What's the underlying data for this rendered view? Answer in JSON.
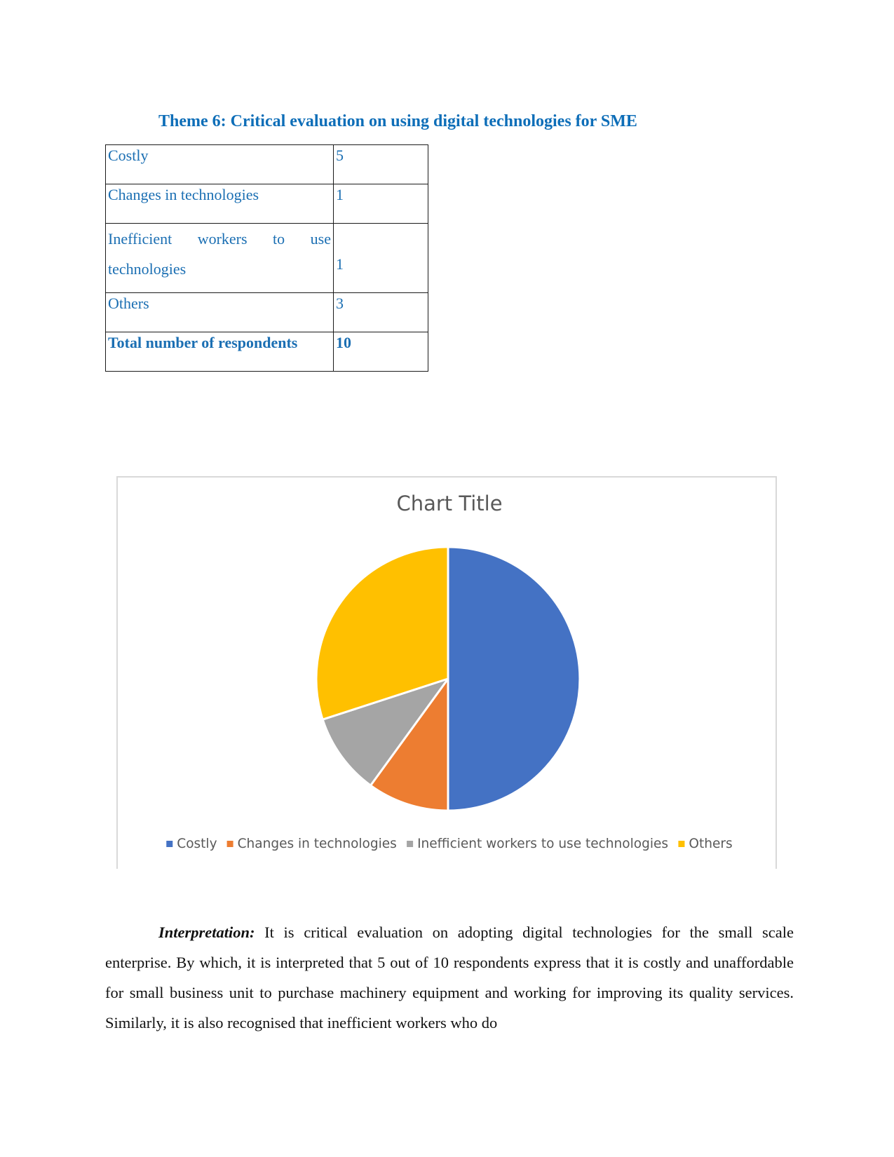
{
  "document": {
    "theme_heading": "Theme 6: Critical evaluation on using digital technologies for SME",
    "table": {
      "rows": [
        {
          "label": "Costly",
          "value": "5"
        },
        {
          "label": "Changes in technologies",
          "value": "1"
        },
        {
          "label": "Inefficient workers to use technologies",
          "value": "1"
        },
        {
          "label": "Others",
          "value": "3"
        }
      ],
      "total": {
        "label": "Total number of respondents",
        "value": "10"
      }
    },
    "interpretation": {
      "lead": "Interpretation:",
      "text": " It is critical evaluation on adopting digital technologies for the small scale enterprise. By which, it is interpreted that 5 out of 10 respondents express that it is costly and unaffordable for small business unit to purchase machinery equipment and working for improving its quality services. Similarly, it is also recognised that inefficient workers who do"
    }
  },
  "colors": {
    "heading": "#0e6eb8",
    "table_text": "#1b6fb3",
    "slice_costly": "#4472c4",
    "slice_changes": "#ed7d31",
    "slice_inefficient": "#a5a5a5",
    "slice_others": "#ffc000"
  },
  "chart_data": {
    "type": "pie",
    "title": "Chart Title",
    "categories": [
      "Costly",
      "Changes in technologies",
      "Inefficient workers to use technologies",
      "Others"
    ],
    "values": [
      5,
      1,
      1,
      3
    ],
    "colors": [
      "#4472c4",
      "#ed7d31",
      "#a5a5a5",
      "#ffc000"
    ],
    "start_angle": "12 o'clock, clockwise",
    "legend_position": "bottom",
    "data_labels": false
  }
}
